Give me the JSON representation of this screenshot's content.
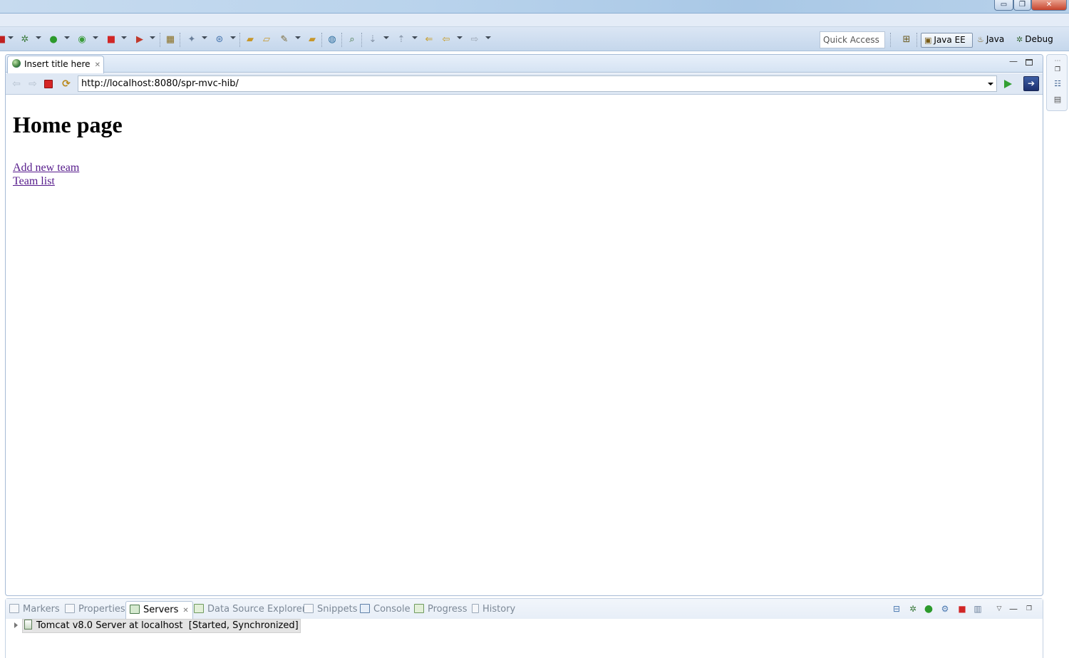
{
  "window": {
    "minimize_glyph": "▭",
    "maximize_glyph": "❐",
    "close_glyph": "✕"
  },
  "toolbar": {
    "quick_access_label": "Quick Access",
    "perspectives": [
      "Java EE",
      "Java",
      "Debug"
    ],
    "icons": [
      "stop-icon",
      "debug-icon",
      "run-icon",
      "coverage-icon",
      "terminate-icon",
      "external-tools-icon",
      "new-server-icon",
      "new-project-icon",
      "publish-icon",
      "open-type-icon",
      "open-folder-icon",
      "build-icon",
      "open-task-icon",
      "web-browser-icon",
      "search-icon",
      "next-annotation-icon",
      "previous-annotation-icon",
      "last-edit-icon",
      "back-icon",
      "forward-icon"
    ]
  },
  "editor": {
    "tab_label": "Insert title here",
    "url": "http://localhost:8080/spr-mvc-hib/",
    "page": {
      "heading": "Home page",
      "links": [
        "Add new team",
        "Team list"
      ]
    }
  },
  "bottom_panel": {
    "tabs": [
      "Markers",
      "Properties",
      "Servers",
      "Data Source Explorer",
      "Snippets",
      "Console",
      "Progress",
      "History"
    ],
    "active_tab": "Servers",
    "servers": [
      {
        "name": "Tomcat v8.0 Server at localhost",
        "status": "[Started, Synchronized]"
      }
    ]
  }
}
